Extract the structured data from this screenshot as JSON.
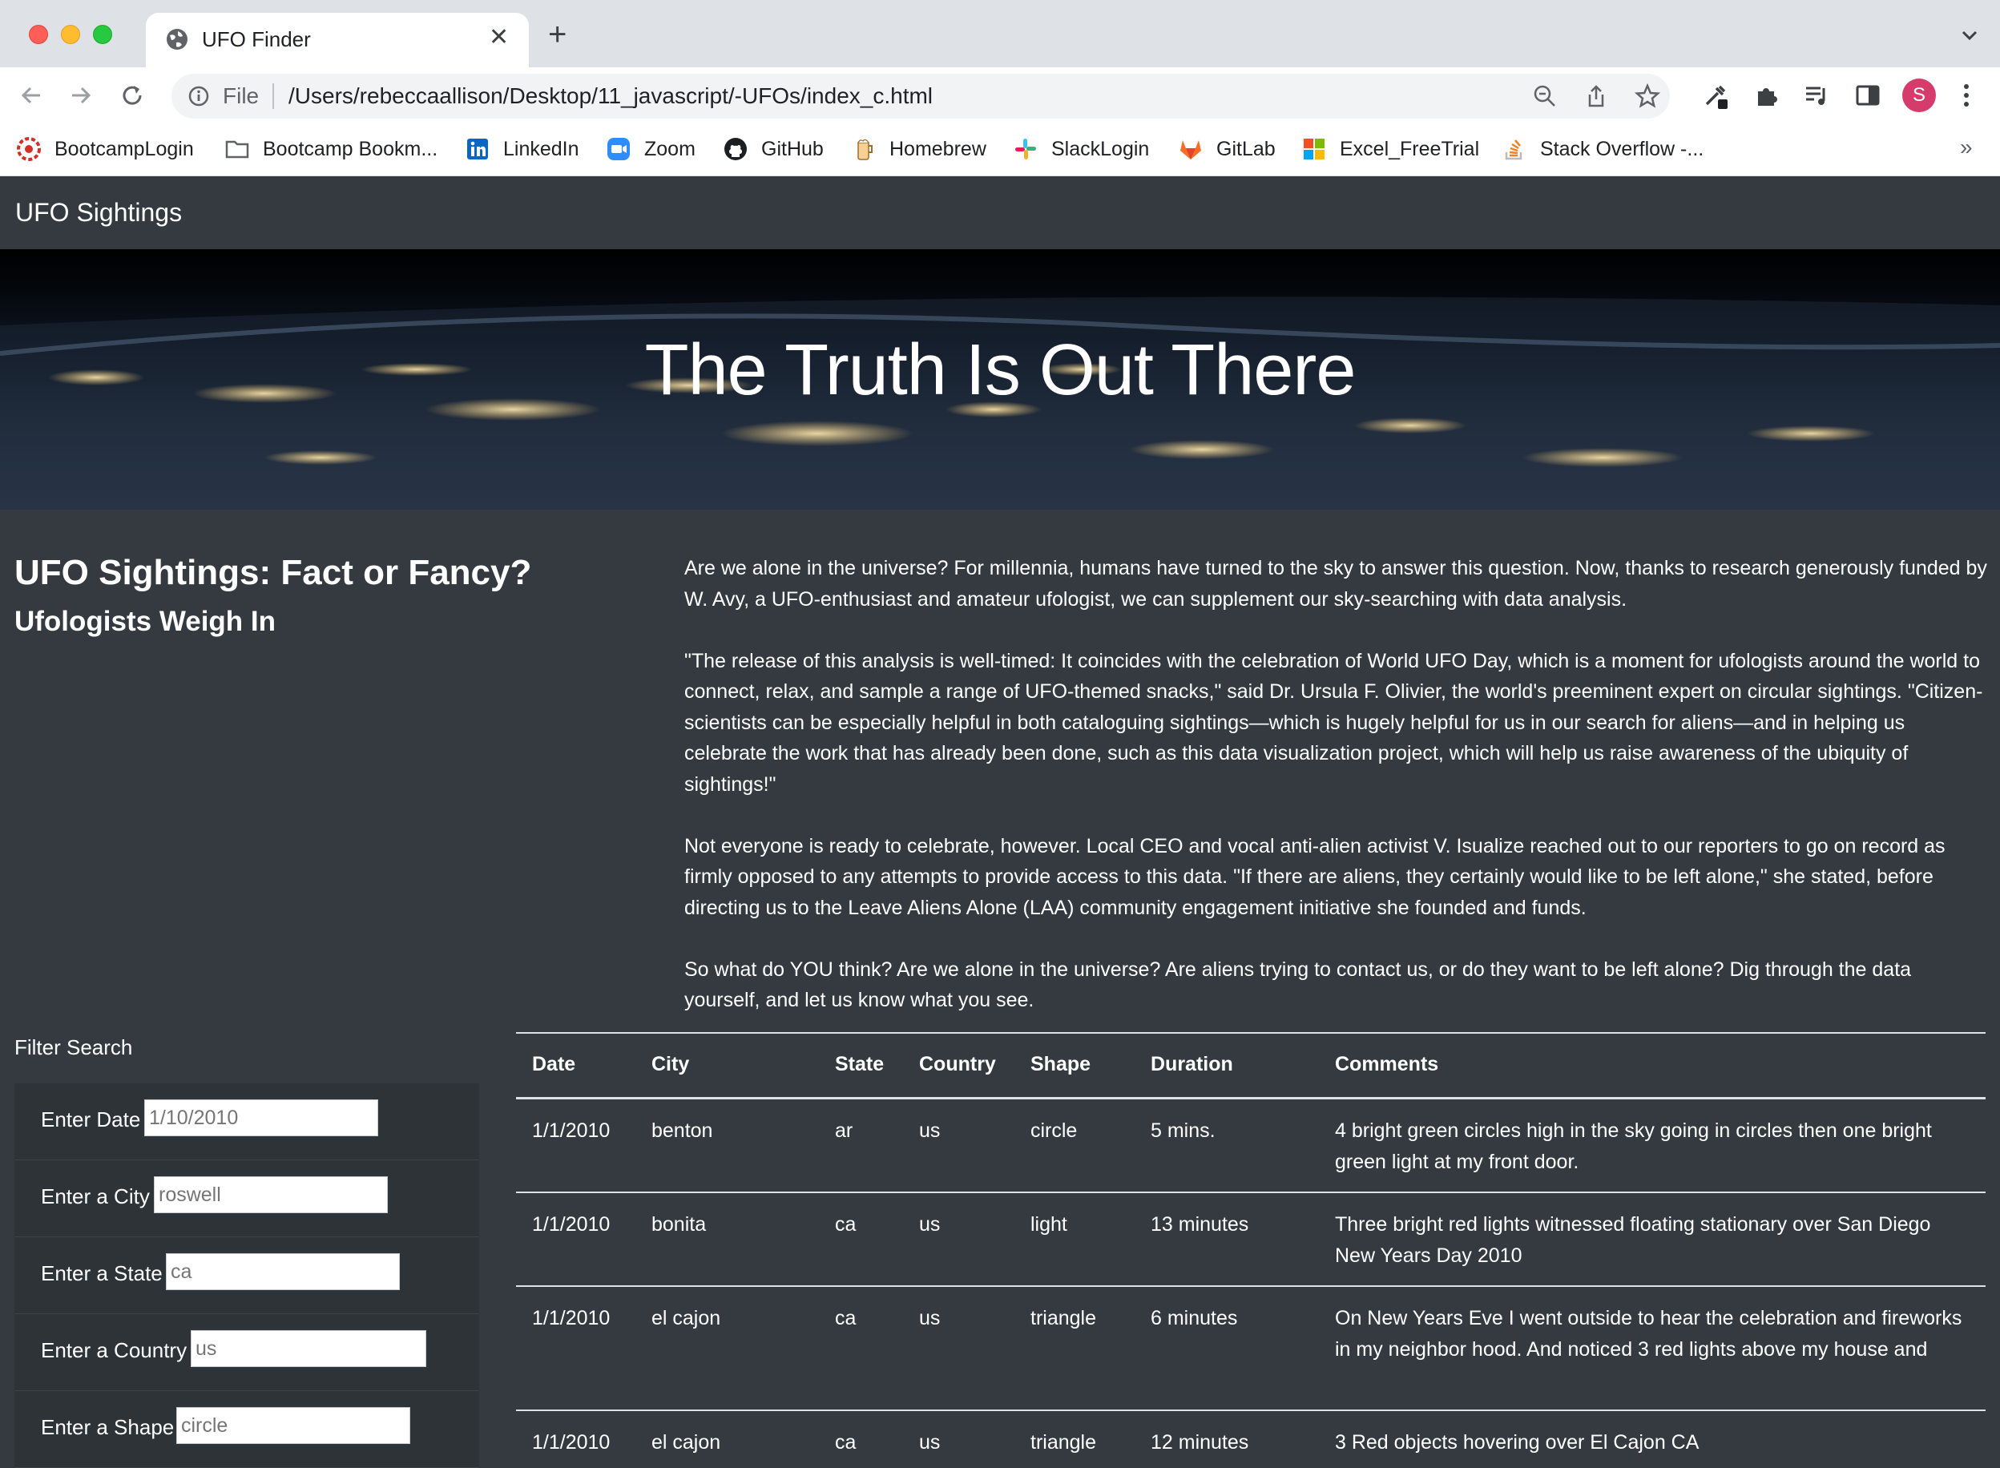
{
  "browser": {
    "tab_title": "UFO Finder",
    "address": {
      "scheme_label": "File",
      "url": "/Users/rebeccaallison/Desktop/11_javascript/-UFOs/index_c.html"
    },
    "profile_initial": "S",
    "bookmarks": [
      {
        "label": "BootcampLogin",
        "icon": "bootcamp-icon"
      },
      {
        "label": "Bootcamp Bookm...",
        "icon": "folder-icon"
      },
      {
        "label": "LinkedIn",
        "icon": "linkedin-icon"
      },
      {
        "label": "Zoom",
        "icon": "zoom-icon"
      },
      {
        "label": "GitHub",
        "icon": "github-icon"
      },
      {
        "label": "Homebrew",
        "icon": "homebrew-icon"
      },
      {
        "label": "SlackLogin",
        "icon": "slack-icon"
      },
      {
        "label": "GitLab",
        "icon": "gitlab-icon"
      },
      {
        "label": "Excel_FreeTrial",
        "icon": "microsoft-icon"
      },
      {
        "label": "Stack Overflow -...",
        "icon": "stackoverflow-icon"
      }
    ],
    "bookmarks_overflow": "»"
  },
  "page": {
    "brand": "UFO Sightings",
    "hero_title": "The Truth Is Out There",
    "heading": {
      "main": "UFO Sightings: Fact or Fancy?",
      "sub": "Ufologists Weigh In"
    },
    "paragraphs": [
      "Are we alone in the universe? For millennia, humans have turned to the sky to answer this question. Now, thanks to research generously funded by W. Avy, a UFO-enthusiast and amateur ufologist, we can supplement our sky-searching with data analysis.",
      "\"The release of this analysis is well-timed: It coincides with the celebration of World UFO Day, which is a moment for ufologists around the world to connect, relax, and sample a range of UFO-themed snacks,\" said Dr. Ursula F. Olivier, the world's preeminent expert on circular sightings. \"Citizen-scientists can be especially helpful in both cataloguing sightings—which is hugely helpful for us in our search for aliens—and in helping us celebrate the work that has already been done, such as this data visualization project, which will help us raise awareness of the ubiquity of sightings!\"",
      "Not everyone is ready to celebrate, however. Local CEO and vocal anti-alien activist V. Isualize reached out to our reporters to go on record as firmly opposed to any attempts to provide access to this data. \"If there are aliens, they certainly would like to be left alone,\" she stated, before directing us to the Leave Aliens Alone (LAA) community engagement initiative she founded and funds.",
      "So what do YOU think? Are we alone in the universe? Are aliens trying to contact us, or do they want to be left alone? Dig through the data yourself, and let us know what you see."
    ],
    "filter": {
      "title": "Filter Search",
      "fields": [
        {
          "label": "Enter Date",
          "placeholder": "1/10/2010"
        },
        {
          "label": "Enter a City",
          "placeholder": "roswell"
        },
        {
          "label": "Enter a State",
          "placeholder": "ca"
        },
        {
          "label": "Enter a Country",
          "placeholder": "us"
        },
        {
          "label": "Enter a Shape",
          "placeholder": "circle"
        }
      ]
    },
    "table": {
      "headers": [
        "Date",
        "City",
        "State",
        "Country",
        "Shape",
        "Duration",
        "Comments"
      ],
      "rows": [
        [
          "1/1/2010",
          "benton",
          "ar",
          "us",
          "circle",
          "5 mins.",
          "4 bright green circles high in the sky going in circles then one bright green light at my front door."
        ],
        [
          "1/1/2010",
          "bonita",
          "ca",
          "us",
          "light",
          "13 minutes",
          "Three bright red lights witnessed floating stationary over San Diego New Years Day 2010"
        ],
        [
          "1/1/2010",
          "el cajon",
          "ca",
          "us",
          "triangle",
          "6 minutes",
          "On New Years Eve I went outside to hear the celebration and fireworks in my neighbor hood. And noticed 3 red lights above my house and"
        ],
        [
          "1/1/2010",
          "el cajon",
          "ca",
          "us",
          "triangle",
          "12 minutes",
          "3 Red objects hovering over El Cajon CA"
        ]
      ]
    }
  }
}
